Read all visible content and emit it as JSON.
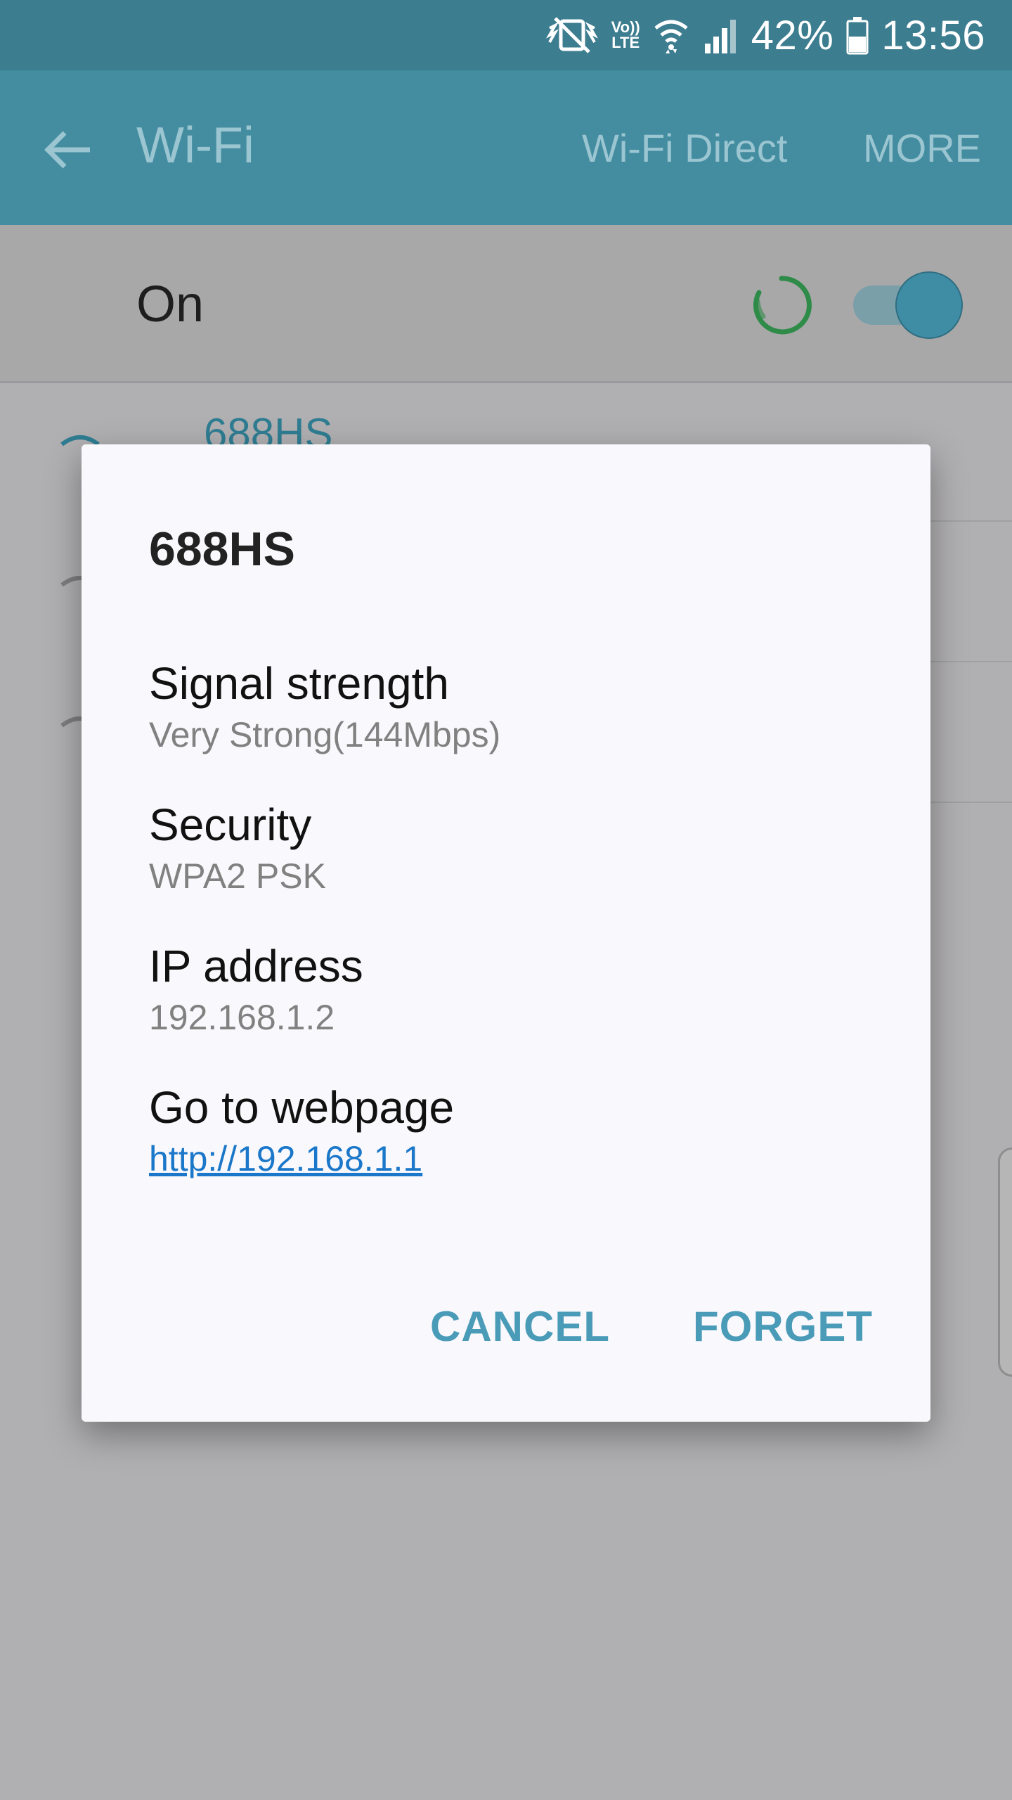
{
  "status_bar": {
    "battery_percent": "42%",
    "time": "13:56",
    "volte_top": "Vo))",
    "volte_bottom": "LTE",
    "icons": [
      "mute-vibrate-icon",
      "volte-icon",
      "wifi-signal-icon",
      "cell-signal-icon",
      "battery-icon"
    ]
  },
  "appbar": {
    "title": "Wi-Fi",
    "wifi_direct_label": "Wi-Fi Direct",
    "more_label": "MORE",
    "colors": {
      "background": "#448da1",
      "status": "#3d7d90"
    }
  },
  "wifi_toggle": {
    "label": "On",
    "state": "on"
  },
  "background_networks": [
    {
      "name": "688HS"
    }
  ],
  "dialog": {
    "title": "688HS",
    "fields": [
      {
        "label": "Signal strength",
        "value": "Very Strong(144Mbps)"
      },
      {
        "label": "Security",
        "value": "WPA2 PSK"
      },
      {
        "label": "IP address",
        "value": "192.168.1.2"
      },
      {
        "label": "Go to webpage",
        "value": "http://192.168.1.1"
      }
    ],
    "cancel_label": "CANCEL",
    "forget_label": "FORGET",
    "accent_color": "#4a9bb7"
  }
}
